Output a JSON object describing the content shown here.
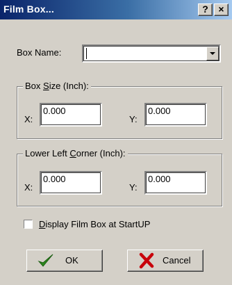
{
  "window": {
    "title": "Film Box...",
    "help_glyph": "?",
    "close_glyph": "×"
  },
  "box_name": {
    "label": "Box Name:",
    "value": ""
  },
  "box_size": {
    "legend_pre": "Box ",
    "legend_mnemonic": "S",
    "legend_post": "ize (Inch):",
    "x_label": "X:",
    "x_value": "0.000",
    "y_label": "Y:",
    "y_value": "0.000"
  },
  "lower_left": {
    "legend_pre": "Lower Left ",
    "legend_mnemonic": "C",
    "legend_post": "orner (Inch):",
    "x_label": "X:",
    "x_value": "0.000",
    "y_label": "Y:",
    "y_value": "0.000"
  },
  "display_checkbox": {
    "label_mnemonic": "D",
    "label_rest": "isplay Film Box at StartUP",
    "checked": false
  },
  "buttons": {
    "ok_label": "OK",
    "cancel_label": "Cancel"
  },
  "icons": {
    "ok": "checkmark-icon",
    "cancel": "x-mark-icon"
  },
  "colors": {
    "title_bar_start": "#0a246a",
    "title_bar_end": "#a6caf0",
    "face": "#d4d0c8",
    "ok_icon": "#2e8b1e",
    "cancel_icon": "#c8000a"
  }
}
